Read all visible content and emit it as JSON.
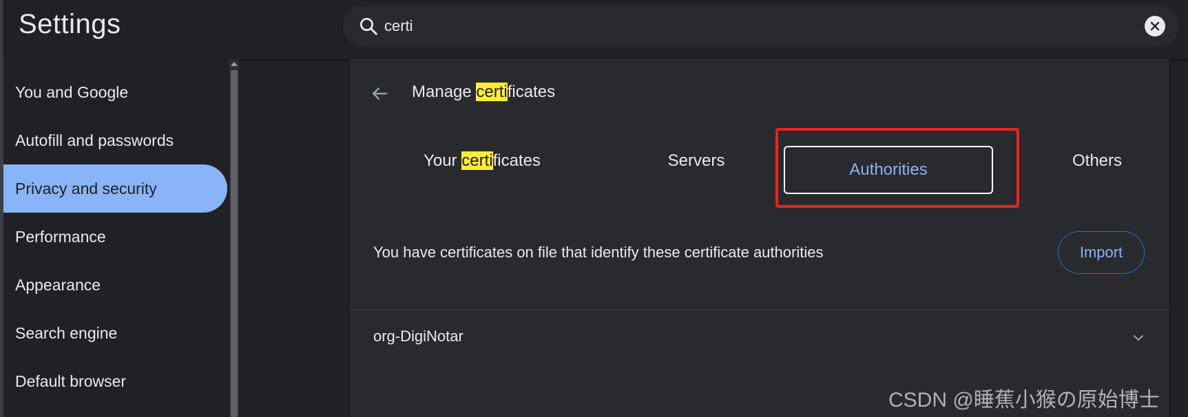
{
  "header": {
    "title": "Settings"
  },
  "search": {
    "value": "certi",
    "placeholder": ""
  },
  "sidebar": {
    "items": [
      {
        "label": "You and Google"
      },
      {
        "label": "Autofill and passwords"
      },
      {
        "label": "Privacy and security",
        "active": true
      },
      {
        "label": "Performance"
      },
      {
        "label": "Appearance"
      },
      {
        "label": "Search engine"
      },
      {
        "label": "Default browser"
      }
    ]
  },
  "main": {
    "title_prefix": "Manage ",
    "title_highlight": "certi",
    "title_suffix": "ficates",
    "tabs": [
      {
        "prefix": "Your ",
        "highlight": "certi",
        "suffix": "ficates"
      },
      {
        "label": "Servers"
      },
      {
        "label": "Authorities",
        "selected": true
      },
      {
        "label": "Others"
      }
    ],
    "description": "You have certificates on file that identify these certificate authorities",
    "import_label": "Import",
    "rows": [
      {
        "label": "org-DigiNotar"
      }
    ]
  },
  "watermark": "CSDN @睡蕉小猴の原始博士",
  "colors": {
    "accent": "#8ab4f8",
    "highlight": "#ffeb3b",
    "annotation": "#e8241c",
    "background": "#202124",
    "card": "#292a2d"
  },
  "icons": {
    "search": "search-icon",
    "clear": "close-icon",
    "back": "back-arrow-icon",
    "expand": "chevron-down-icon"
  }
}
